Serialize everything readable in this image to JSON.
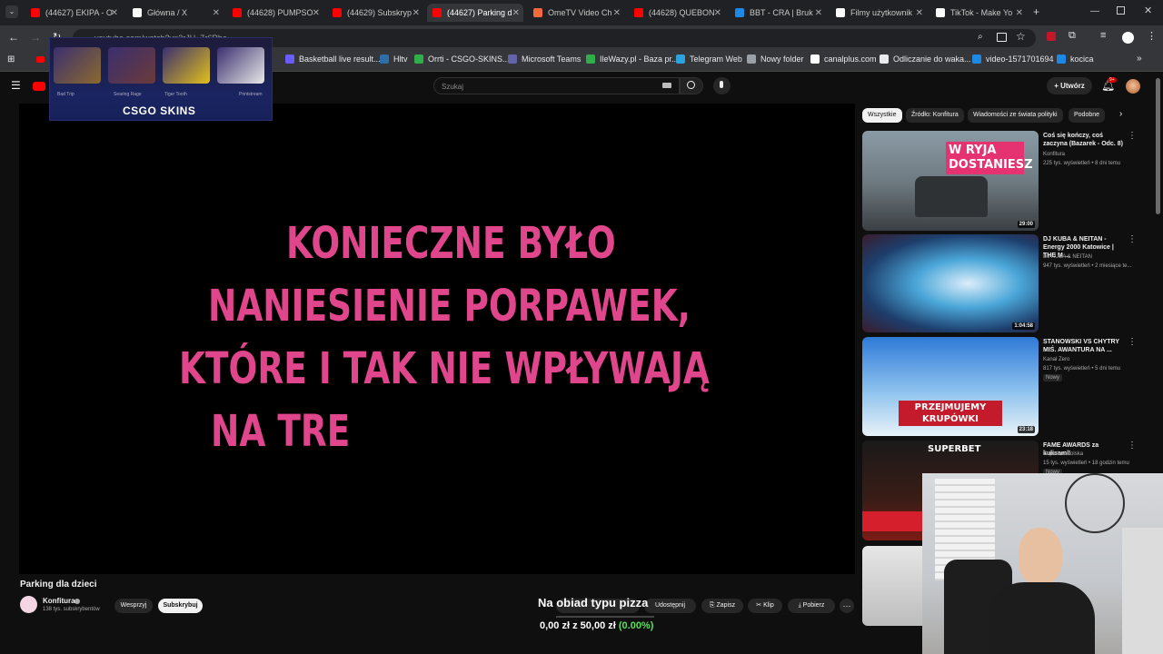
{
  "browser": {
    "tabs": [
      {
        "title": "(44627) EKIPA - O",
        "color": "#ff0000",
        "active": false
      },
      {
        "title": "Główna / X",
        "color": "#ffffff",
        "active": false
      },
      {
        "title": "(44628) PUMPSO",
        "color": "#ff0000",
        "active": false
      },
      {
        "title": "(44629) Subskryp",
        "color": "#ff0000",
        "active": false
      },
      {
        "title": "(44627) Parking d",
        "color": "#ff0000",
        "active": true
      },
      {
        "title": "OmeTV Video Ch",
        "color": "#f36a3d",
        "active": false
      },
      {
        "title": "(44628) QUEBON",
        "color": "#ff0000",
        "active": false
      },
      {
        "title": "BBT - CRA | Bruk",
        "color": "#1e88e5",
        "active": false
      },
      {
        "title": "Filmy użytkownik",
        "color": "#ffffff",
        "active": false
      },
      {
        "title": "TikTok - Make Yo",
        "color": "#ffffff",
        "active": false
      }
    ],
    "url": "youtube.com/watch?v=3rJH_7r6Rho",
    "bookmarks": [
      {
        "label": "Basketball live result...",
        "color": "#6a5cff"
      },
      {
        "label": "Hltv",
        "color": "#2b6ea8"
      },
      {
        "label": "Orrti - CSGO-SKINS...",
        "color": "#2fae4a"
      },
      {
        "label": "Microsoft Teams",
        "color": "#6264a7"
      },
      {
        "label": "IleWazy.pl - Baza pr...",
        "color": "#2fae4a"
      },
      {
        "label": "Telegram Web",
        "color": "#2aa3df"
      },
      {
        "label": "Nowy folder",
        "color": "#9aa0a6"
      },
      {
        "label": "canalplus.com",
        "color": "#ffffff"
      },
      {
        "label": "Odliczanie do waka...",
        "color": "#e8eaed"
      },
      {
        "label": "video-1571701694",
        "color": "#1e88e5"
      },
      {
        "label": "kocica",
        "color": "#1e88e5"
      }
    ]
  },
  "youtube": {
    "search_placeholder": "Szukaj",
    "create_label": "Utwórz",
    "notif_badge": "9+",
    "accent": "#ff0000"
  },
  "ad": {
    "brand": "CSGO SKINS",
    "items": [
      "Bad Trip",
      "Searing Rage",
      "Tiger Tooth",
      "Printstream"
    ]
  },
  "video": {
    "subtitle_lines": [
      "KONIECZNE BYŁO",
      "NANIESIENIE PORPAWEK,",
      "KTÓRE I TAK NIE WPŁYWAJĄ",
      "NA TRE"
    ],
    "subtitle_color": "#e0468c",
    "title": "Parking dla dzieci",
    "channel": "Konfitura",
    "subscribers": "138 tys. subskrybentów",
    "support_label": "Wesprzyj",
    "subscribe_label": "Subskrybuj",
    "actions": {
      "share": "Udostępnij",
      "save": "Zapisz",
      "clip": "Klip",
      "download": "Pobierz"
    }
  },
  "donation": {
    "title": "Na obiad typu pizza",
    "current": "0,00 zł",
    "sep": "z",
    "goal": "50,00 zł",
    "percent": "(0.00%)"
  },
  "sidebar": {
    "chips": [
      "Wszystkie",
      "Źródło: Konfitura",
      "Wiadomości ze świata polityki",
      "Podobne"
    ],
    "videos": [
      {
        "title": "Coś się kończy, coś zaczyna (Bazarek - Odc. 8)",
        "channel": "Konfitura",
        "meta": "225 tys. wyświetleń • 8 dni temu",
        "duration": "29:00",
        "badge": "",
        "overlay": "W RYJA DOSTANIESZ"
      },
      {
        "title": "DJ KUBA & NEITAN - Energy 2000 Katowice | THE M ...",
        "channel": "DJ KUBA & NEITAN",
        "meta": "947 tys. wyświetleń • 2 miesiące te...",
        "duration": "1:04:58",
        "badge": "",
        "overlay": ""
      },
      {
        "title": "STANOWSKI VS CHYTRY MIŚ. AWANTURA NA ...",
        "channel": "Kanał Zero",
        "meta": "817 tys. wyświetleń • 5 dni temu",
        "duration": "23:18",
        "badge": "Nowy",
        "overlay": "PRZEJMUJEMY KRUPÓWKI"
      },
      {
        "title": "FAME AWARDS za kulisami!",
        "channel": "Superbet Polska",
        "meta": "15 tys. wyświetleń • 18 godzin temu",
        "duration": "",
        "badge": "Nowy",
        "overlay": "SUPERBET"
      }
    ]
  }
}
